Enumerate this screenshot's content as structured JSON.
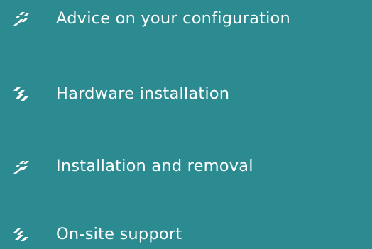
{
  "colors": {
    "background": "#2b8b91",
    "text": "#ffffff",
    "icon": "#ffffff"
  },
  "services": [
    {
      "label": "Advice on your configuration",
      "icon": "stacked-bars-icon"
    },
    {
      "label": "Hardware installation",
      "icon": "slashes-icon"
    },
    {
      "label": "Installation and removal",
      "icon": "stacked-bars-icon"
    },
    {
      "label": "On-site support",
      "icon": "slashes-icon"
    }
  ]
}
